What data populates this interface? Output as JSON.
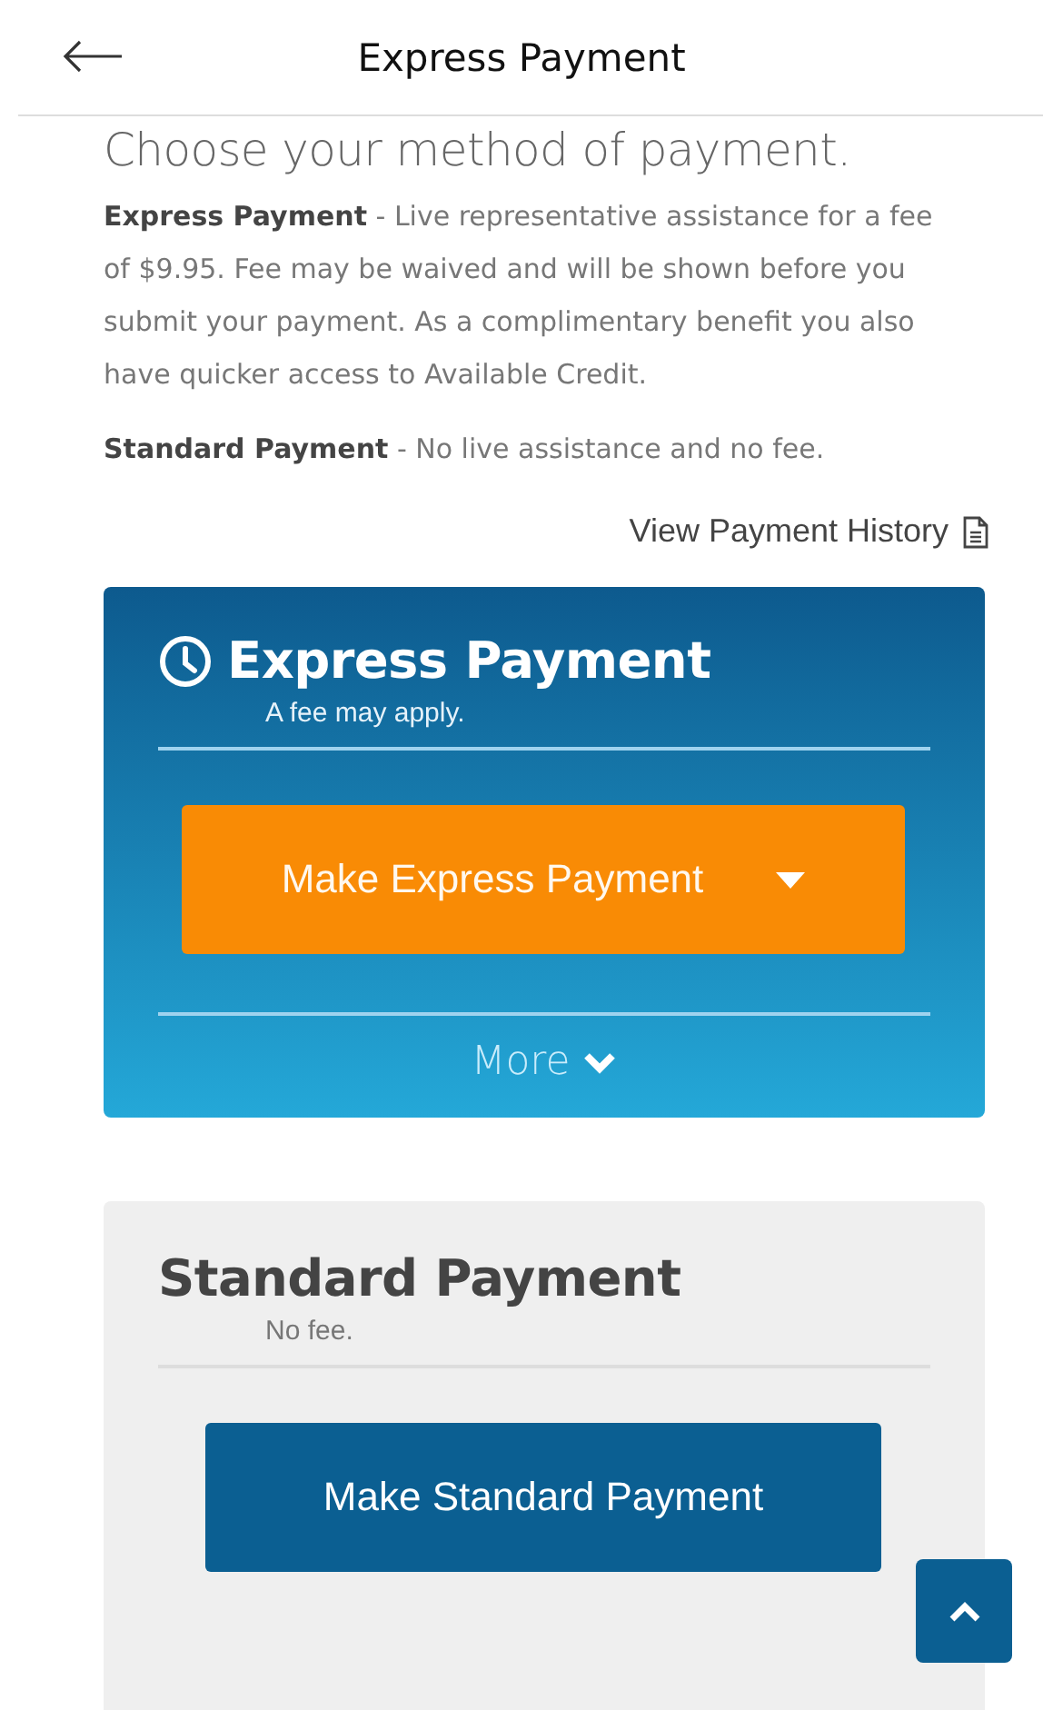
{
  "header": {
    "title": "Express Payment"
  },
  "intro": {
    "heading": "Choose your method of payment.",
    "paragraphs": [
      "**Express Payment** - Live representative assistance for a fee of $9.95. Fee may be waived and will be shown before you submit your payment. As a complimentary benefit you also have quicker access to Available Credit.",
      "**Standard Payment** - No live assistance and no fee."
    ]
  },
  "history_link": "View Payment History",
  "cards": [
    {
      "kind": "express",
      "title": "Express Payment",
      "subtitle": "A fee may apply.",
      "button": "Make Express Payment",
      "more": "More",
      "expanded": false
    },
    {
      "kind": "standard",
      "title": "Standard Payment",
      "subtitle": "No fee.",
      "button": "Make Standard Payment"
    }
  ]
}
